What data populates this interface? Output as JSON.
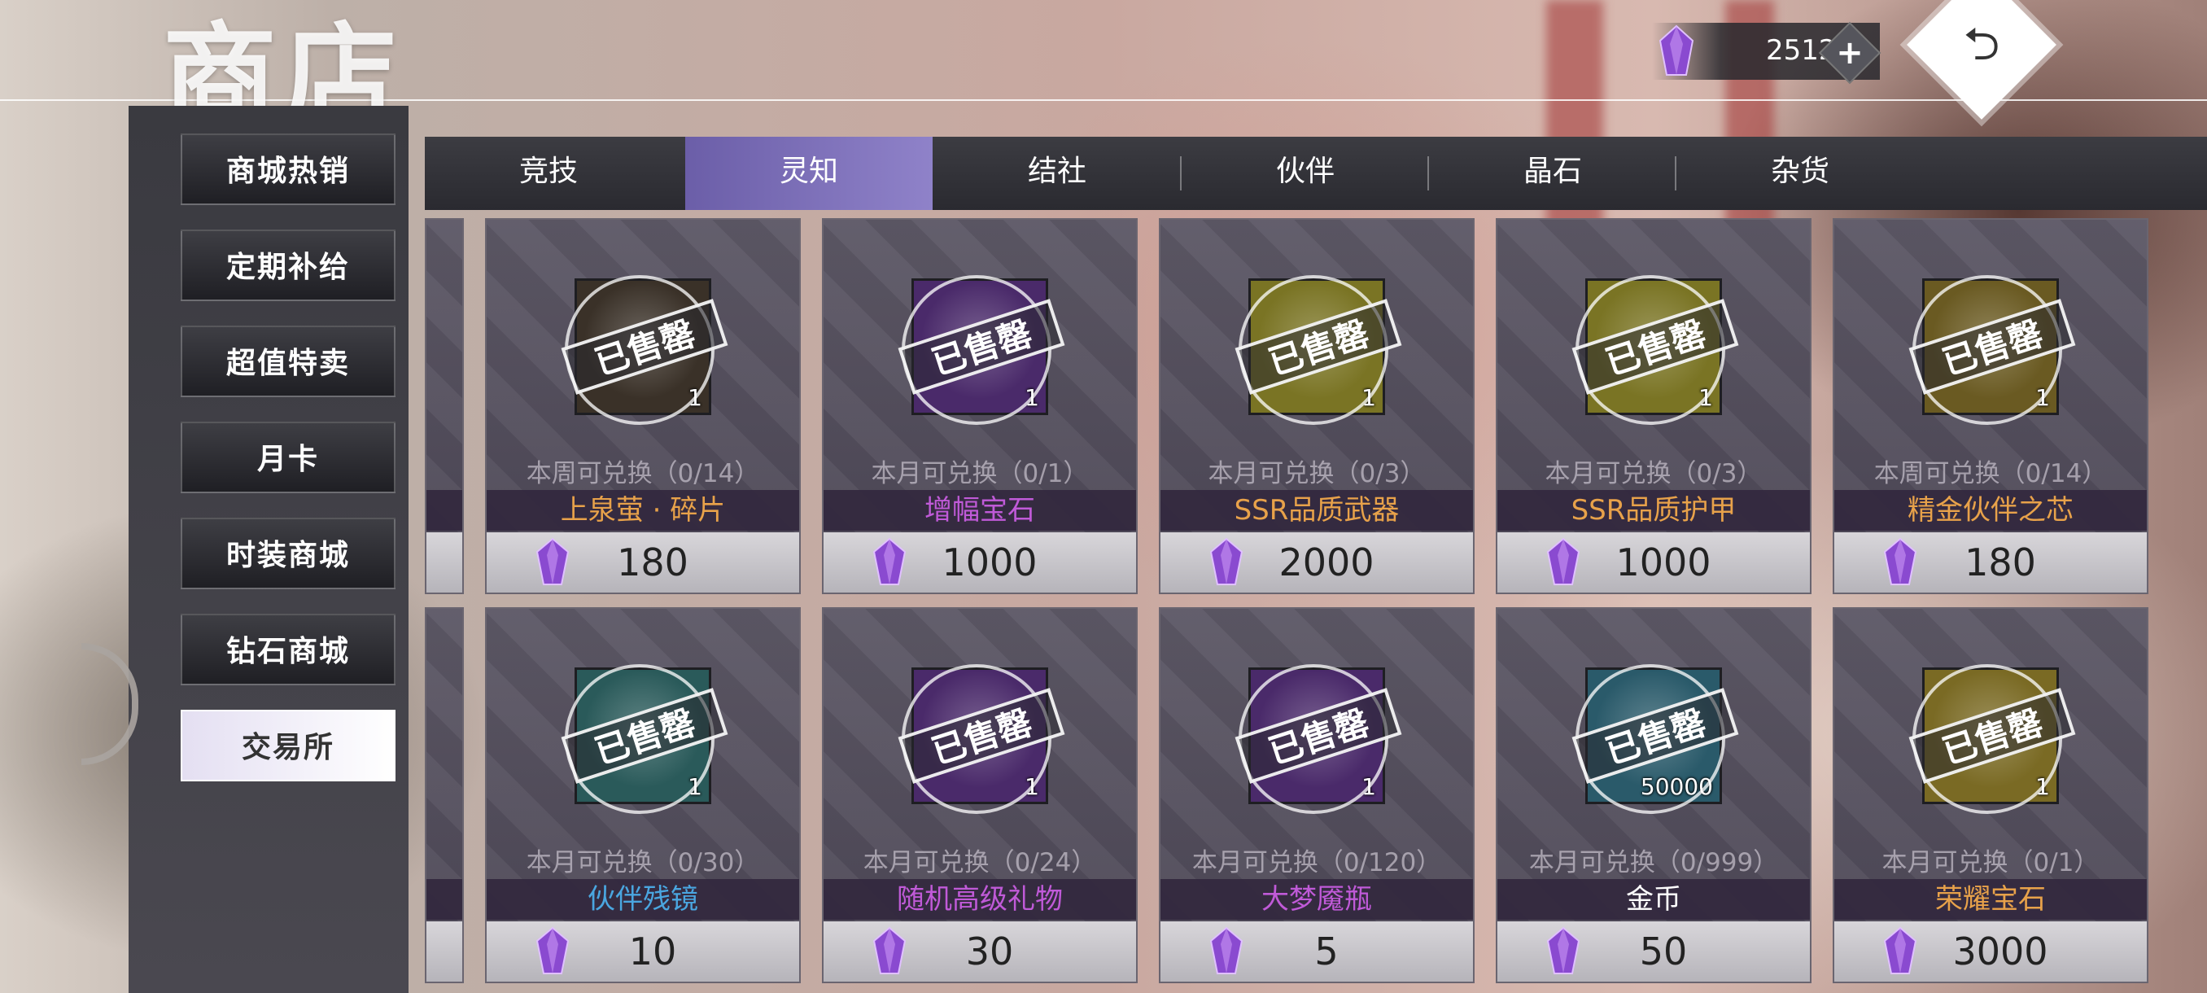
{
  "header": {
    "title": "商店",
    "currency_value": "2512",
    "currency_plus": "+",
    "back_symbol": "⮌"
  },
  "sidebar": {
    "items": [
      {
        "label": "商城热销"
      },
      {
        "label": "定期补给"
      },
      {
        "label": "超值特卖"
      },
      {
        "label": "月卡"
      },
      {
        "label": "时装商城"
      },
      {
        "label": "钻石商城"
      },
      {
        "label": "交易所",
        "active": true
      }
    ]
  },
  "tabs": [
    {
      "label": "竞技"
    },
    {
      "label": "灵知",
      "active": true
    },
    {
      "label": "结社"
    },
    {
      "label": "伙伴"
    },
    {
      "label": "晶石"
    },
    {
      "label": "杂货"
    }
  ],
  "sold_text": "已售罄",
  "items": [
    {
      "name": "上泉萤 · 碎片",
      "limit": "本周可兑换（0/14）",
      "price": "180",
      "qty": "1",
      "name_color": "#e8a24a",
      "icon_color": "#3a3128"
    },
    {
      "name": "增幅宝石",
      "limit": "本月可兑换（0/1）",
      "price": "1000",
      "qty": "1",
      "name_color": "#c05ad8",
      "icon_color": "#4a2a6a"
    },
    {
      "name": "SSR品质武器",
      "limit": "本月可兑换（0/3）",
      "price": "2000",
      "qty": "1",
      "name_color": "#e8a24a",
      "icon_color": "#7a7424"
    },
    {
      "name": "SSR品质护甲",
      "limit": "本月可兑换（0/3）",
      "price": "1000",
      "qty": "1",
      "name_color": "#e8a24a",
      "icon_color": "#7a7424"
    },
    {
      "name": "精金伙伴之芯",
      "limit": "本周可兑换（0/14）",
      "price": "180",
      "qty": "1",
      "name_color": "#e8a24a",
      "icon_color": "#6a5a22"
    },
    {
      "name": "伙伴残镜",
      "limit": "本月可兑换（0/30）",
      "price": "10",
      "qty": "1",
      "name_color": "#4aa6e0",
      "icon_color": "#2a5a5a"
    },
    {
      "name": "随机高级礼物",
      "limit": "本月可兑换（0/24）",
      "price": "30",
      "qty": "1",
      "name_color": "#c05ad8",
      "icon_color": "#4a2a6a"
    },
    {
      "name": "大梦魇瓶",
      "limit": "本月可兑换（0/120）",
      "price": "5",
      "qty": "1",
      "name_color": "#c05ad8",
      "icon_color": "#4a2a6a"
    },
    {
      "name": "金币",
      "limit": "本月可兑换（0/999）",
      "price": "50",
      "qty": "50000",
      "name_color": "#ffffff",
      "icon_color": "#2a5a6a"
    },
    {
      "name": "荣耀宝石",
      "limit": "本月可兑换（0/1）",
      "price": "3000",
      "qty": "1",
      "name_color": "#e8a24a",
      "icon_color": "#7a6a24"
    }
  ],
  "icons": {
    "gem": "purple-crystal-icon",
    "back": "return-arrow-icon",
    "plus": "plus-icon"
  },
  "colors": {
    "tab_active": "#7d70b8",
    "gem": "#8a4ad0"
  }
}
